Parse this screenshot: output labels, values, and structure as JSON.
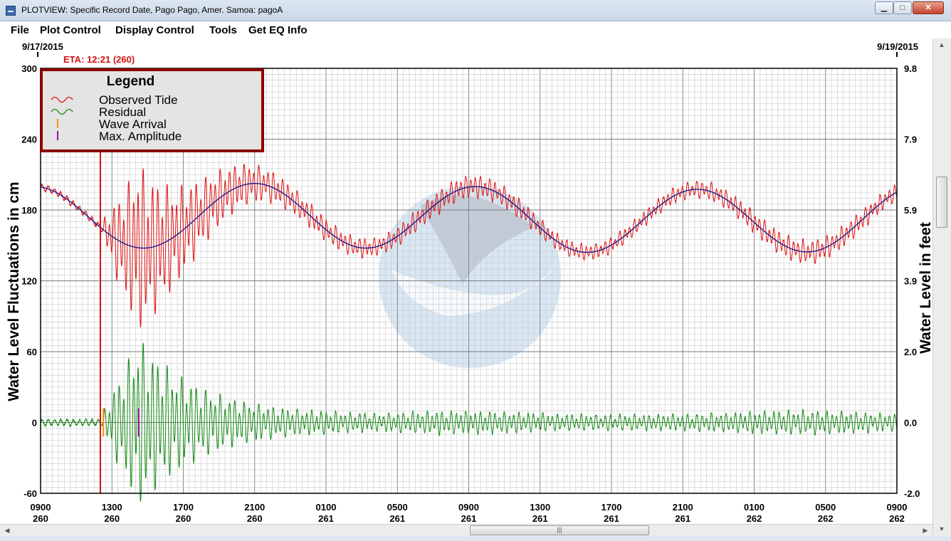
{
  "window": {
    "title": "PLOTVIEW: Specific Record Date, Pago Pago, Amer. Samoa: pagoA",
    "minimize_glyph": "▁",
    "maximize_glyph": "□",
    "close_glyph": "✕",
    "app_icon": "plotview-app-icon"
  },
  "menu": [
    "File",
    "Plot Control",
    "Display Control",
    "Tools",
    "Get EQ Info"
  ],
  "scroll": {
    "left_glyph": "◀",
    "right_glyph": "▶",
    "up_glyph": "▲",
    "down_glyph": "▼",
    "grip": "|||"
  },
  "chart_data": {
    "type": "line",
    "date_start": "9/17/2015",
    "date_end": "9/19/2015",
    "eta_label": "ETA: 12:21 (260)",
    "eta_position": 3.35,
    "y_label_left": "Water Level Fluctuations in cm",
    "y_label_right": "Water Level in feet",
    "ylim_left": [
      -60,
      300
    ],
    "ylim_right": [
      -2.0,
      9.8
    ],
    "yticks_left": [
      "300",
      "240",
      "180",
      "120",
      "60",
      "0",
      "-60"
    ],
    "yticks_right": [
      "9.8",
      "7.9",
      "5.9",
      "3.9",
      "2.0",
      "0.0",
      "-2.0"
    ],
    "xticks": [
      {
        "time": "0900",
        "day": "260"
      },
      {
        "time": "1300",
        "day": "260"
      },
      {
        "time": "1700",
        "day": "260"
      },
      {
        "time": "2100",
        "day": "260"
      },
      {
        "time": "0100",
        "day": "261"
      },
      {
        "time": "0500",
        "day": "261"
      },
      {
        "time": "0900",
        "day": "261"
      },
      {
        "time": "1300",
        "day": "261"
      },
      {
        "time": "1700",
        "day": "261"
      },
      {
        "time": "2100",
        "day": "261"
      },
      {
        "time": "0100",
        "day": "262"
      },
      {
        "time": "0500",
        "day": "262"
      },
      {
        "time": "0900",
        "day": "262"
      }
    ],
    "legend": {
      "title": "Legend",
      "placement": "top-left",
      "entries": [
        {
          "label": "Observed Tide",
          "color": "#e01010"
        },
        {
          "label": "Residual",
          "color": "#108a10"
        },
        {
          "label": "Wave Arrival",
          "color": "#ff8c00"
        },
        {
          "label": "Max. Amplitude",
          "color": "#a000a0"
        }
      ]
    },
    "colors": {
      "observed": "#e01010",
      "predicted": "#10108c",
      "residual": "#108a10",
      "eta_line": "#d01010",
      "wave_arrival": "#ff8c00",
      "max_amplitude": "#a000a0",
      "legend_border": "#8b0000",
      "watermark": "#b8d4ea"
    },
    "grid": true,
    "tide_mean_cm": 173,
    "tide_amplitude_cm": 27,
    "tide_period_hours": 12.4,
    "tide_peaks": [
      {
        "hour": 12.0,
        "cm": 198
      },
      {
        "hour": 24.3,
        "cm": 203
      },
      {
        "hour": 36.6,
        "cm": 195
      }
    ],
    "wave_arrival_hour": 3.52,
    "max_amplitude_hour": 5.5,
    "max_residual_cm": 65,
    "min_residual_cm": -57
  }
}
